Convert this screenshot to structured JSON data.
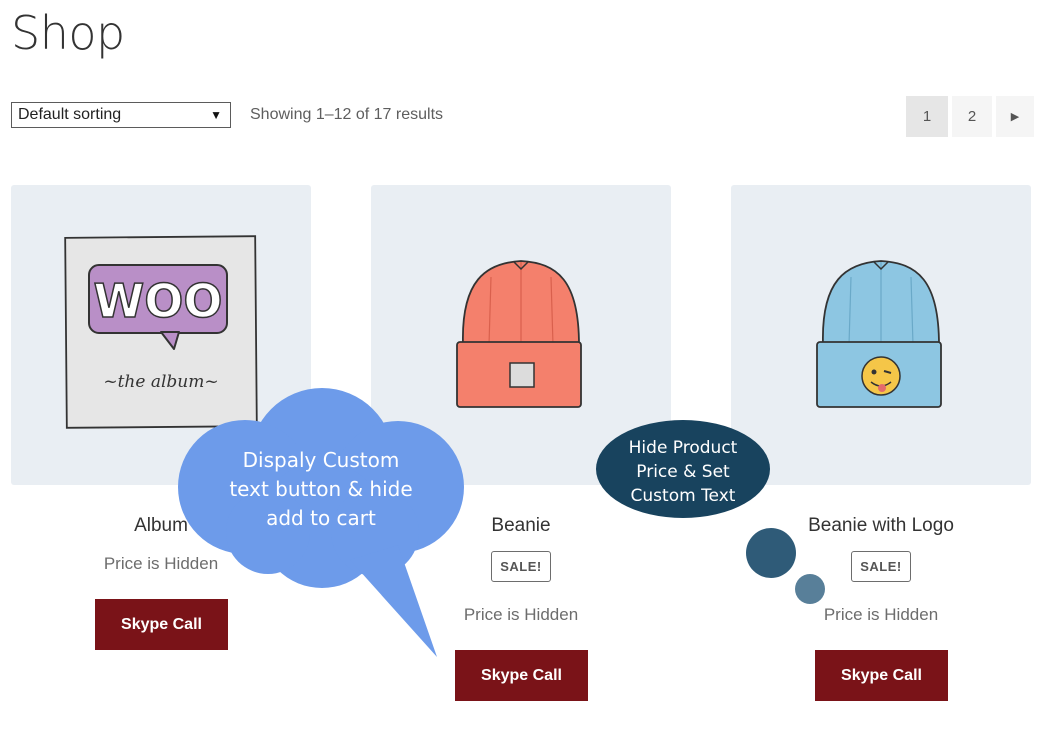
{
  "page": {
    "title": "Shop"
  },
  "toolbar": {
    "sorting_value": "Default sorting",
    "result_count": "Showing 1–12 of 17 results"
  },
  "pagination": {
    "pages": [
      "1",
      "2"
    ],
    "current": "1",
    "next_icon": "caret-right-icon"
  },
  "products": [
    {
      "name": "Album",
      "sale": "",
      "price": "Price is Hidden",
      "button": "Skype Call",
      "image": "woo-album-art"
    },
    {
      "name": "Beanie",
      "sale": "SALE!",
      "price": "Price is Hidden",
      "button": "Skype Call",
      "image": "orange-beanie"
    },
    {
      "name": "Beanie with Logo",
      "sale": "SALE!",
      "price": "Price is Hidden",
      "button": "Skype Call",
      "image": "blue-beanie-with-emoji-logo"
    }
  ],
  "image_text": {
    "woo": "WOO",
    "album": "~the album~"
  },
  "callouts": {
    "cloud": "Dispaly Custom text button & hide add to cart",
    "thought": "Hide Product Price & Set Custom Text"
  },
  "colors": {
    "button": "#7a1318",
    "cloud": "#6d9bea",
    "thought": "#18435e",
    "thumb_bg": "#e9eef3"
  }
}
